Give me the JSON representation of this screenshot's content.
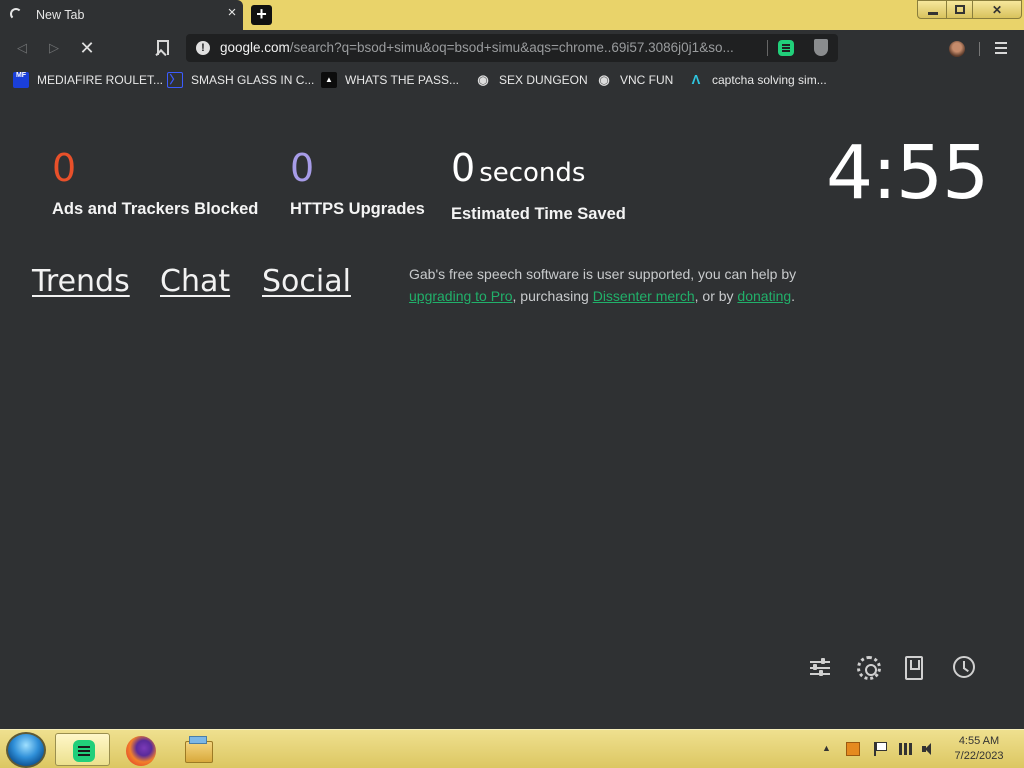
{
  "browser": {
    "tab": {
      "title": "New Tab",
      "close_label": "×"
    },
    "new_tab_label": "+",
    "window_controls": {
      "close_label": "✕"
    },
    "nav": {
      "back": "◁",
      "forward": "▷",
      "stop": "✕"
    },
    "url": {
      "info_label": "!",
      "host": "google.com",
      "rest": "/search?q=bsod+simu&oq=bsod+simu&aqs=chrome..69i57.3086j0j1&so..."
    },
    "bookmarks": [
      {
        "label": "MEDIAFIRE ROULET...",
        "icon": "mediafire-icon",
        "icon_text": "MF\nT",
        "color": "#1a3fd9"
      },
      {
        "label": "SMASH GLASS IN C...",
        "icon": "chevron-logo-icon",
        "icon_text": "〉",
        "color": "#2f3133"
      },
      {
        "label": "WHATS THE PASS...",
        "icon": "site-icon",
        "icon_text": "▲",
        "color": "#111111"
      },
      {
        "label": "SEX DUNGEON",
        "icon": "globe-icon",
        "icon_text": "◉",
        "color": "#2f3133"
      },
      {
        "label": "VNC FUN",
        "icon": "globe-icon",
        "icon_text": "◉",
        "color": "#2f3133"
      },
      {
        "label": "captcha solving sim...",
        "icon": "arch-logo-icon",
        "icon_text": "Λ",
        "color": "#2f3133"
      }
    ]
  },
  "newtab": {
    "stats": {
      "ads": {
        "value": "0",
        "caption": "Ads and Trackers Blocked",
        "color": "#e8502a"
      },
      "https": {
        "value": "0",
        "caption": "HTTPS Upgrades",
        "color": "#a79ce8"
      },
      "time": {
        "value": "0",
        "unit": "seconds",
        "caption": "Estimated Time Saved",
        "color": "#ffffff"
      }
    },
    "clock": "4:55",
    "links": {
      "trends": "Trends",
      "chat": "Chat",
      "social": "Social"
    },
    "gab_note": {
      "text1": "Gab's free speech software is user supported, you can help by ",
      "link_pro": "upgrading to Pro",
      "text2": ", purchasing ",
      "link_merch": "Dissenter merch",
      "text3": ", or by ",
      "link_donate": "donating",
      "text4": "."
    },
    "icons": [
      "sliders-icon",
      "gear-icon",
      "bookmarks-icon",
      "history-icon"
    ]
  },
  "taskbar": {
    "apps": [
      "gab-dissenter",
      "firefox",
      "file-explorer"
    ],
    "tray_up": "▲",
    "time": "4:55 AM",
    "date": "7/22/2023"
  }
}
